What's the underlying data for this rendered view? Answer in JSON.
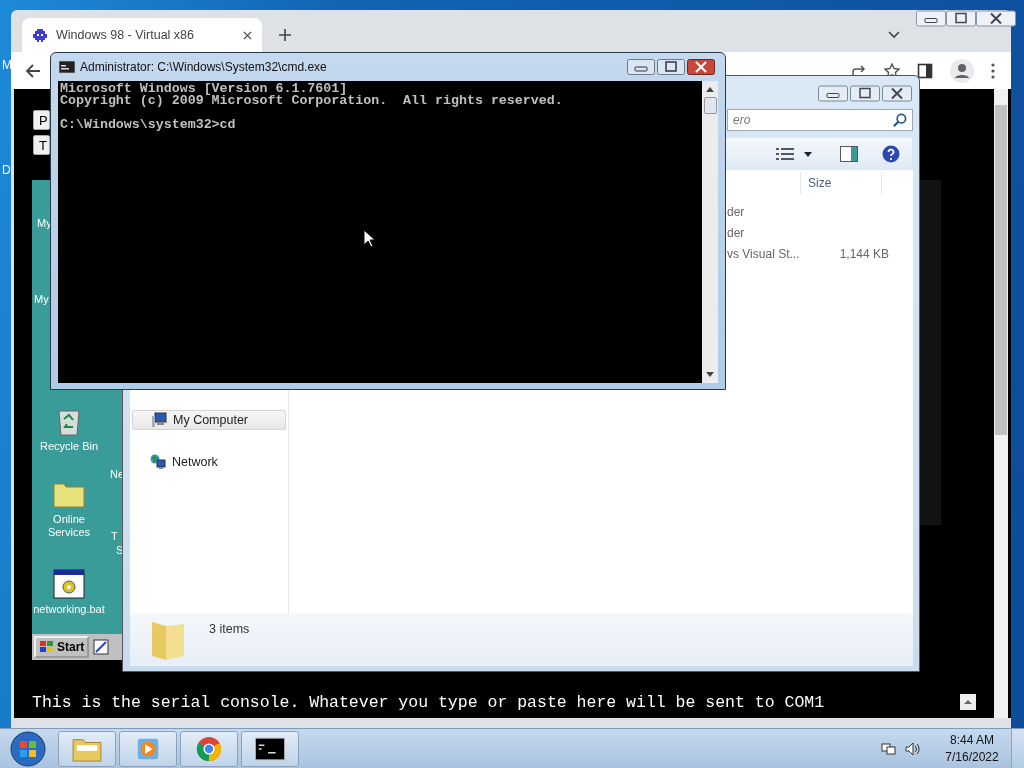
{
  "host_desktop": {
    "partial_labels": [
      "M",
      "D"
    ]
  },
  "browser": {
    "tabs": [
      {
        "title": "Windows 98 - Virtual x86",
        "selected": true
      }
    ]
  },
  "emulator": {
    "buttons": [
      "P",
      "T"
    ],
    "desktop_icons": [
      {
        "label": "My",
        "kind": "hidden"
      },
      {
        "label": "My",
        "kind": "hidden"
      },
      {
        "label": "Recycle Bin",
        "kind": "recycle"
      },
      {
        "label": "Online Services",
        "kind": "folder"
      },
      {
        "label": "networking.bat",
        "kind": "batch"
      }
    ],
    "partial_labels": [
      "Ne",
      "T",
      "S"
    ],
    "start_button": "Start",
    "serial_console": "This is the serial console. Whatever you type or paste here will be sent to COM1"
  },
  "explorer": {
    "search": {
      "value": "ero"
    },
    "columns": [
      "Size"
    ],
    "rows": [
      {
        "name": "der"
      },
      {
        "name": "der"
      },
      {
        "name": "vs Visual St...",
        "size": "1,144 KB"
      }
    ],
    "nav": [
      {
        "label": "My Computer",
        "kind": "computer",
        "selected": true
      },
      {
        "label": "Network",
        "kind": "network",
        "selected": false
      }
    ],
    "status": "3 items"
  },
  "cmd": {
    "title": "Administrator: C:\\Windows\\System32\\cmd.exe",
    "output": [
      "Microsoft Windows [Version 6.1.7601]",
      "Copyright (c) 2009 Microsoft Corporation.  All rights reserved."
    ],
    "prompt": "C:\\Windows\\system32>cd"
  },
  "taskbar": {
    "buttons": [
      {
        "kind": "explorer"
      },
      {
        "kind": "media"
      },
      {
        "kind": "chrome"
      },
      {
        "kind": "console"
      }
    ],
    "clock": {
      "time": "8:44 AM",
      "date": "7/16/2022"
    }
  }
}
